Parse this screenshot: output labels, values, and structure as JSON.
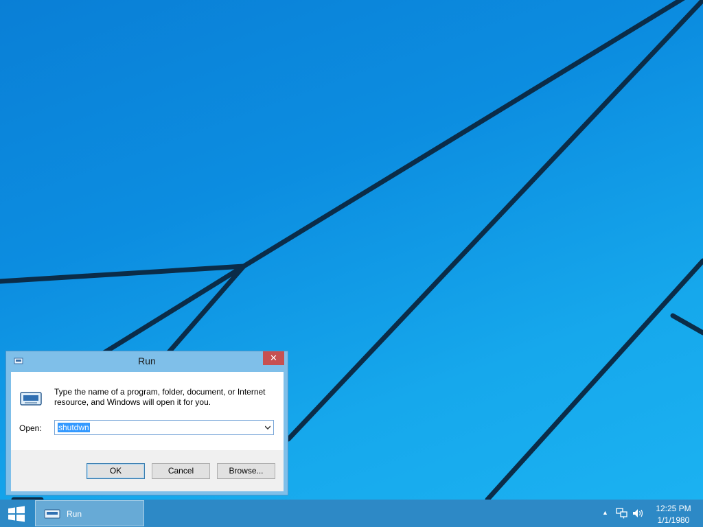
{
  "desktop": {
    "wallpaper_name": "windows-lines-wallpaper",
    "accent": "#0f96e4"
  },
  "run_dialog": {
    "title": "Run",
    "close_glyph": "✕",
    "description": "Type the name of a program, folder, document, or Internet resource, and Windows will open it for you.",
    "open_label": "Open:",
    "open_value": "shutdwn",
    "buttons": {
      "ok": "OK",
      "cancel": "Cancel",
      "browse": "Browse..."
    }
  },
  "taskbar": {
    "start_icon": "windows-logo-icon",
    "running_task_label": "Run",
    "tray": {
      "chevron": "▲",
      "network_icon": "network-icon",
      "volume_icon": "volume-icon"
    },
    "clock": {
      "time": "12:25 PM",
      "date": "1/1/1980"
    }
  }
}
